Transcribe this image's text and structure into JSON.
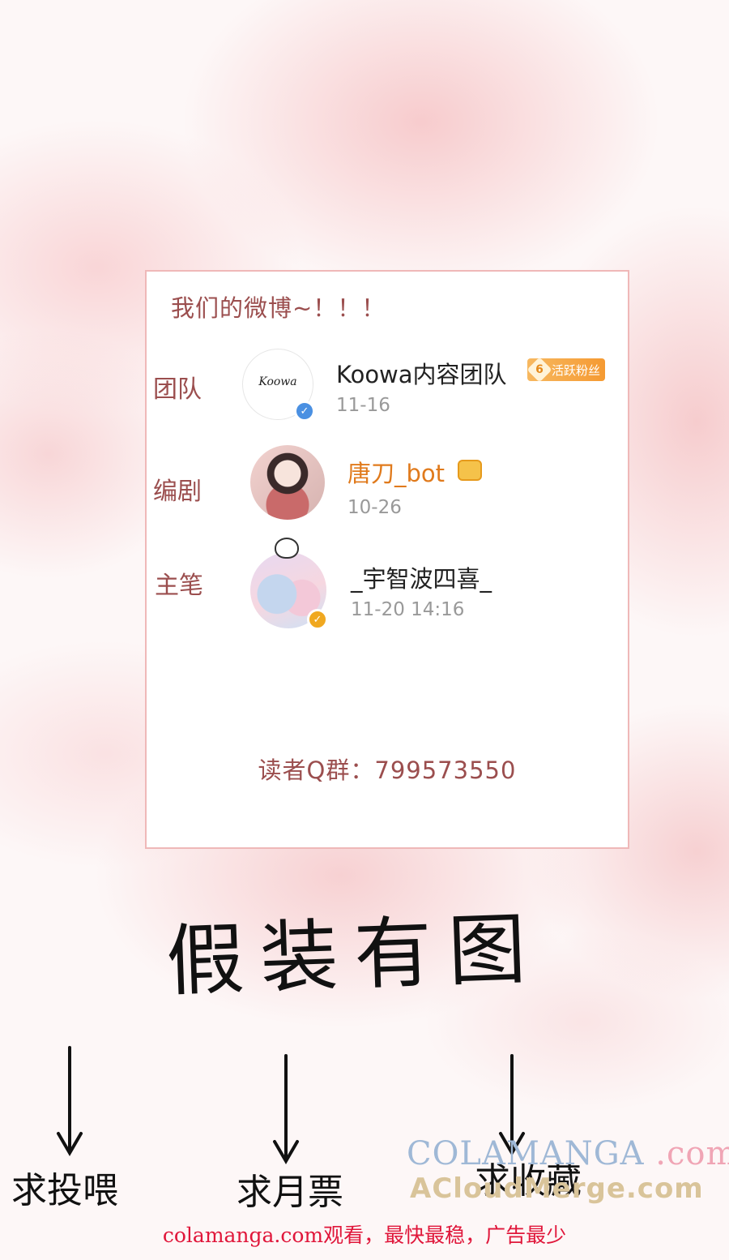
{
  "card": {
    "title": "我们的微博~！！！",
    "entries": [
      {
        "role": "团队",
        "avatar_text": "Koowa",
        "name": "Koowa内容团队",
        "badge_level": "6",
        "badge_text": "活跃粉丝",
        "date": "11-16",
        "verify_color": "#4a90e2",
        "verify_icon": "check-icon"
      },
      {
        "role": "编剧",
        "name": "唐刀_bot",
        "name_color": "#e07a1c",
        "date": "10-26",
        "icon": "crown-icon"
      },
      {
        "role": "主笔",
        "name": "_宇智波四喜_",
        "date": "11-20 14:16",
        "verify_color": "#f0a820",
        "verify_icon": "check-icon"
      }
    ],
    "qq_group": "读者Q群：799573550"
  },
  "handwriting": {
    "title": "假装有图",
    "labels": [
      "求投喂",
      "求月票",
      "求收藏"
    ]
  },
  "watermark": {
    "line1": "COLAMANGA",
    "line1_suffix": ".com",
    "line2": "ACloudMerge.com"
  },
  "footer": "colamanga.com观看，最快最稳，广告最少",
  "colors": {
    "accent": "#9b4e4e",
    "border": "#efb8b8",
    "footer": "#e0163a"
  }
}
